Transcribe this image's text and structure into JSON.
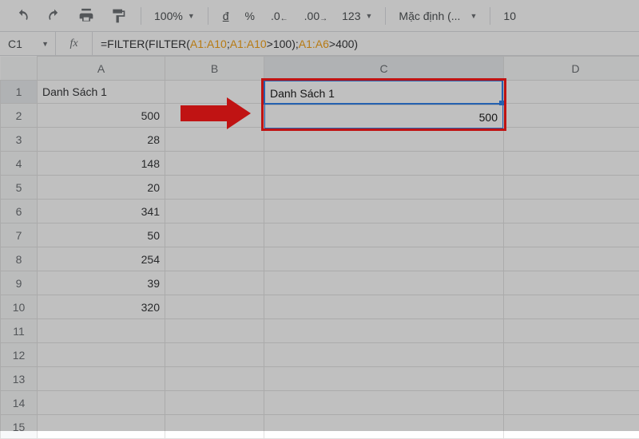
{
  "toolbar": {
    "zoom": "100%",
    "currency_btn": "đ",
    "percent_btn": "%",
    "dec_dec": ".0",
    "dec_inc": ".00",
    "more_formats": "123",
    "font_name": "Mặc định (...",
    "font_size": "10"
  },
  "namebox": {
    "ref": "C1",
    "fx_label": "fx"
  },
  "formula": {
    "p0": "=FILTER(FILTER(",
    "r0": "A1:A10",
    "p1": ";",
    "r1": "A1:A10",
    "p2": ">100);",
    "r2": "A1:A6",
    "p3": ">400)"
  },
  "columns": [
    "A",
    "B",
    "C",
    "D"
  ],
  "rows": [
    {
      "n": "1",
      "A": "Danh Sách 1",
      "A_align": "txt"
    },
    {
      "n": "2",
      "A": "500",
      "A_align": "num"
    },
    {
      "n": "3",
      "A": "28",
      "A_align": "num"
    },
    {
      "n": "4",
      "A": "148",
      "A_align": "num"
    },
    {
      "n": "5",
      "A": "20",
      "A_align": "num"
    },
    {
      "n": "6",
      "A": "341",
      "A_align": "num"
    },
    {
      "n": "7",
      "A": "50",
      "A_align": "num"
    },
    {
      "n": "8",
      "A": "254",
      "A_align": "num"
    },
    {
      "n": "9",
      "A": "39",
      "A_align": "num"
    },
    {
      "n": "10",
      "A": "320",
      "A_align": "num"
    },
    {
      "n": "11"
    },
    {
      "n": "12"
    },
    {
      "n": "13"
    },
    {
      "n": "14"
    },
    {
      "n": "15"
    }
  ],
  "spill": {
    "c1": "Danh Sách 1",
    "c2": "500"
  }
}
